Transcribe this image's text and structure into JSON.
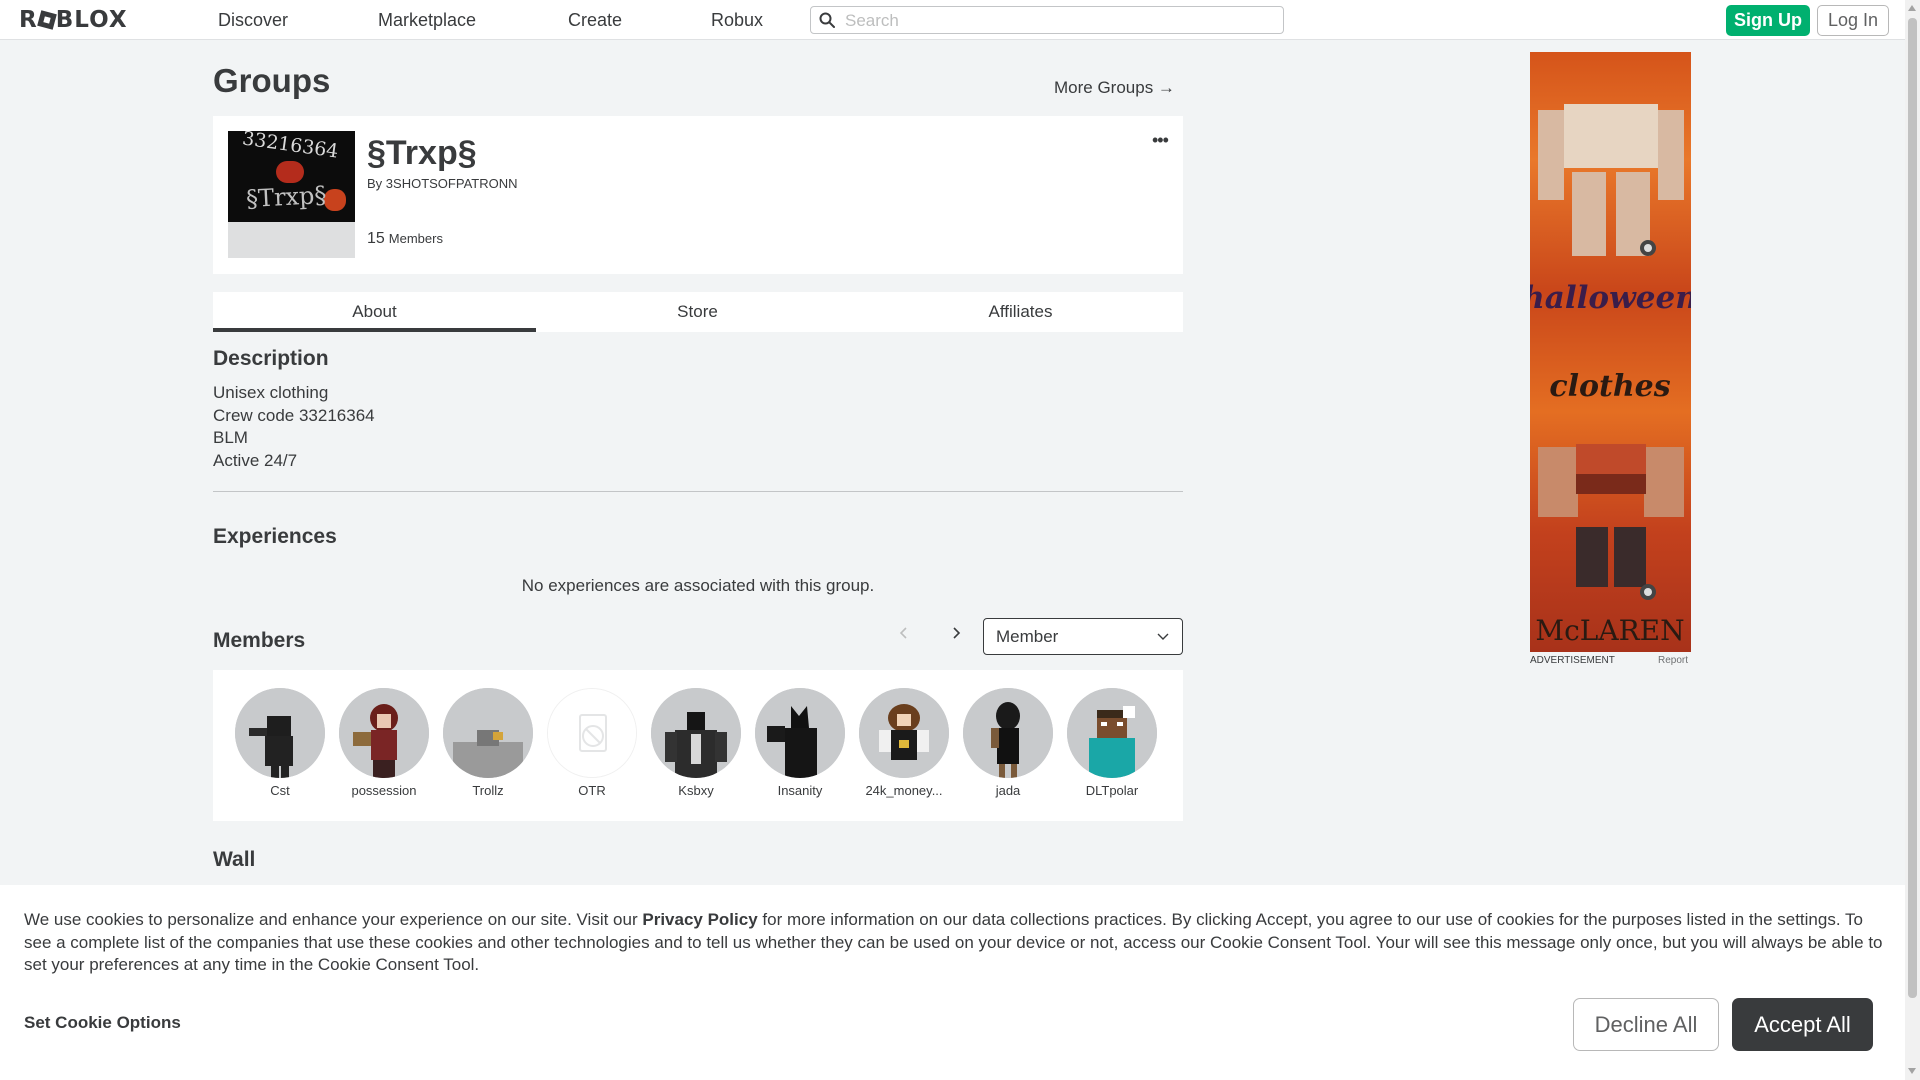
{
  "nav": {
    "logo": "ROBLOX",
    "links": [
      "Discover",
      "Marketplace",
      "Create",
      "Robux"
    ],
    "search_placeholder": "Search",
    "signup": "Sign Up",
    "login": "Log In"
  },
  "page": {
    "title": "Groups",
    "more_groups": "More Groups →"
  },
  "group": {
    "name": "§Trxp§",
    "owner_prefix": "By",
    "owner": "3SHOTSOFPATRONN",
    "member_count": "15",
    "member_label": "Members",
    "emblem_text": "33216364",
    "emblem_text2": "§Trxp§"
  },
  "tabs": [
    "About",
    "Store",
    "Affiliates"
  ],
  "about": {
    "description_title": "Description",
    "description_lines": [
      "Unisex clothing",
      "Crew code 33216364",
      "BLM",
      "Active 24/7"
    ],
    "experiences_title": "Experiences",
    "no_experiences": "No experiences are associated with this group."
  },
  "members": {
    "title": "Members",
    "role_selected": "Member",
    "list": [
      {
        "name": "Cst",
        "avatar": "avatar-black-hood"
      },
      {
        "name": "possession",
        "avatar": "avatar-red-hair"
      },
      {
        "name": "Trollz",
        "avatar": "avatar-gray"
      },
      {
        "name": "OTR",
        "avatar": "avatar-unavailable"
      },
      {
        "name": "Ksbxy",
        "avatar": "avatar-dark-jacket"
      },
      {
        "name": "Insanity",
        "avatar": "avatar-black-wolf"
      },
      {
        "name": "24k_money...",
        "avatar": "avatar-brown-hair"
      },
      {
        "name": "jada",
        "avatar": "avatar-black-dress"
      },
      {
        "name": "DLTpolar",
        "avatar": "avatar-blocky"
      }
    ]
  },
  "wall": {
    "title": "Wall"
  },
  "ad": {
    "label": "ADVERTISEMENT",
    "report": "Report",
    "line1": "halloween",
    "line2": "clothes",
    "line3": "McLAREN"
  },
  "cookie": {
    "text_pre": "We use cookies to personalize and enhance your experience on our site. Visit our ",
    "privacy_link": "Privacy Policy",
    "text_post": " for more information on our data collections practices. By clicking Accept, you agree to our use of cookies for the purposes listed in the settings. To see a complete list of the companies that use these cookies and other technologies and to tell us whether they can be used on your device or not, access our Cookie Consent Tool. Your will see this message only once, but you will always be able to set your preferences at any time in the Cookie Consent Tool.",
    "set_options": "Set Cookie Options",
    "decline": "Decline All",
    "accept": "Accept All"
  },
  "colors": {
    "signup_green": "#00b06f",
    "accept_dark": "#393b3d",
    "page_bg": "#f2f4f5"
  }
}
